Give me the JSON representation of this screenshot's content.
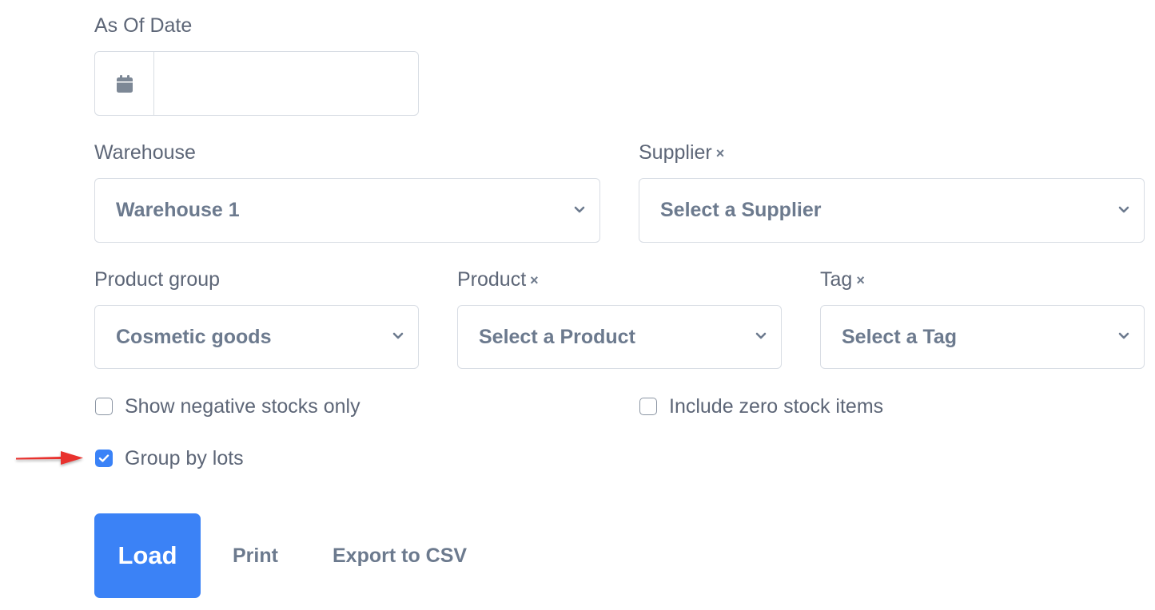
{
  "as_of_date": {
    "label": "As Of Date",
    "value": "",
    "icon": "calendar-icon"
  },
  "warehouse": {
    "label": "Warehouse",
    "value": "Warehouse 1"
  },
  "supplier": {
    "label": "Supplier",
    "clear": "×",
    "value": "Select a Supplier"
  },
  "product_group": {
    "label": "Product group",
    "value": "Cosmetic goods"
  },
  "product": {
    "label": "Product",
    "clear": "×",
    "value": "Select a Product"
  },
  "tag": {
    "label": "Tag",
    "clear": "×",
    "value": "Select a Tag"
  },
  "checkboxes": {
    "negative_only": {
      "label": "Show negative stocks only",
      "checked": false
    },
    "zero_stock": {
      "label": "Include zero stock items",
      "checked": false
    },
    "group_by_lots": {
      "label": "Group by lots",
      "checked": true
    }
  },
  "actions": {
    "load": "Load",
    "print": "Print",
    "export_csv": "Export to CSV"
  },
  "annotation": {
    "arrow_color": "#e8302e"
  },
  "colors": {
    "accent": "#3b82f6",
    "text": "#5d6677",
    "border": "#d8dde4"
  }
}
